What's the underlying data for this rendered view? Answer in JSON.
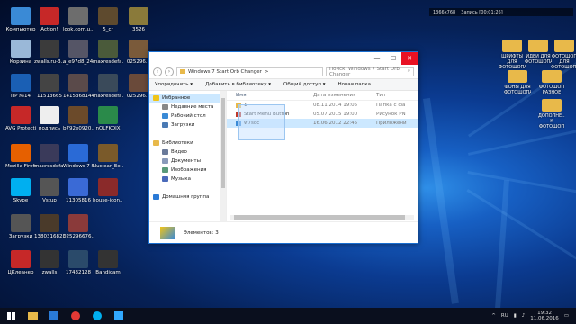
{
  "desktop": {
    "icons": [
      {
        "label": "Компьютер",
        "color": "#3a8ad6"
      },
      {
        "label": "Action!",
        "color": "#c62828"
      },
      {
        "label": "look.com.u...",
        "color": "#6d6d6d"
      },
      {
        "label": "5_cr",
        "color": "#5e4a2e"
      },
      {
        "label": "3526",
        "color": "#8a7a3a"
      },
      {
        "label": "Корзина",
        "color": "#9ab8d8"
      },
      {
        "label": "zwalls.ru-3...",
        "color": "#3b3b3b"
      },
      {
        "label": "a_e97d8_24...",
        "color": "#556"
      },
      {
        "label": "maxresdefa...",
        "color": "#4a5a3a"
      },
      {
        "label": "025296...",
        "color": "#7a5a3a"
      },
      {
        "label": "ПР №14",
        "color": "#1a5fb4"
      },
      {
        "label": "11513665",
        "color": "#444"
      },
      {
        "label": "1415368144...",
        "color": "#5a4a4a"
      },
      {
        "label": "maxresdefa...",
        "color": "#3a4a5a"
      },
      {
        "label": "025296...",
        "color": "#6a4a3a"
      },
      {
        "label": "AVG Protection",
        "color": "#c62828"
      },
      {
        "label": "подпись",
        "color": "#eeeeee"
      },
      {
        "label": "b792e0920...",
        "color": "#6b4a2a"
      },
      {
        "label": "nQLFKOIX",
        "color": "#2a8a4a"
      },
      {
        "label": "Mozilla Firefox",
        "color": "#e66000"
      },
      {
        "label": "maxresdefa...",
        "color": "#3a3a5a"
      },
      {
        "label": "Windows 7 Start Orb...",
        "color": "#2a6ad6"
      },
      {
        "label": "Nuclear_Ex...",
        "color": "#7a5a2a"
      },
      {
        "label": "Skype",
        "color": "#00aff0"
      },
      {
        "label": "Vstup",
        "color": "#555"
      },
      {
        "label": "11305816",
        "color": "#3a6ad6"
      },
      {
        "label": "house-icon...",
        "color": "#8a2a2a"
      },
      {
        "label": "Загрузки",
        "color": "#555"
      },
      {
        "label": "1380316823...",
        "color": "#4a3a2a"
      },
      {
        "label": "025296676...",
        "color": "#8a3a3a"
      },
      {
        "label": "ЦКлеанер",
        "color": "#c62828"
      },
      {
        "label": "zwalls",
        "color": "#333"
      },
      {
        "label": "17432128",
        "color": "#2a4a6a"
      },
      {
        "label": "Bandicam",
        "color": "#333"
      }
    ],
    "right_icons": [
      {
        "label": "ШРИФТЫ ДЛЯ ФОТОШОПА"
      },
      {
        "label": "ИДЕИ ДЛЯ ФОТОШОПА"
      },
      {
        "label": "ФОТОШОП ДЛЯ ФОТОШОПА"
      },
      {
        "label": "ФОНЫ ДЛЯ ФОТОШОПА"
      },
      {
        "label": "ФОТОШОП РАЗНОЕ"
      },
      {
        "label": "ДОПОЛНЕ... К ФОТОШОП"
      }
    ]
  },
  "recorder": {
    "resolution": "1366x768",
    "rec": "Запись [00:01:26]"
  },
  "window": {
    "path": [
      "Windows 7 Start Orb Changer",
      ">"
    ],
    "search_placeholder": "Поиск: Windows 7 Start Orb Changer",
    "toolbar": [
      "Упорядочить ▾",
      "Добавить в библиотеку ▾",
      "Общий доступ ▾",
      "Новая папка"
    ],
    "nav": [
      {
        "label": "Избранное",
        "head": true,
        "color": "#f0c419",
        "sel": true
      },
      {
        "label": "Недавние места",
        "color": "#888"
      },
      {
        "label": "Рабочий стол",
        "color": "#3a8ad6"
      },
      {
        "label": "Загрузки",
        "color": "#4a7ab4"
      },
      {
        "label": "",
        "color": "transparent"
      },
      {
        "label": "Библиотеки",
        "head": true,
        "color": "#e8b94a"
      },
      {
        "label": "Видео",
        "color": "#6a7a9a"
      },
      {
        "label": "Документы",
        "color": "#8a9aba"
      },
      {
        "label": "Изображения",
        "color": "#5a9a7a"
      },
      {
        "label": "Музыка",
        "color": "#4a6aba"
      },
      {
        "label": "",
        "color": "transparent"
      },
      {
        "label": "Домашняя группа",
        "head": true,
        "color": "#2a7ad6"
      }
    ],
    "columns": [
      "Имя",
      "Дата изменения",
      "Тип"
    ],
    "files": [
      {
        "name": "1",
        "date": "08.11.2014 19:05",
        "type": "Папка с фа",
        "color": "#e8b94a"
      },
      {
        "name": "Start Menu Button",
        "date": "05.07.2015 19:00",
        "type": "Рисунок PN",
        "color": "#c0392b"
      },
      {
        "name": "w7soc",
        "date": "16.06.2012 22:45",
        "type": "Приложени",
        "color": "#3a8ad6",
        "sel": true
      }
    ],
    "status": "Элементов: 3"
  },
  "taskbar": {
    "lang": "RU",
    "time": "19:32",
    "date": "11.06.2016"
  }
}
